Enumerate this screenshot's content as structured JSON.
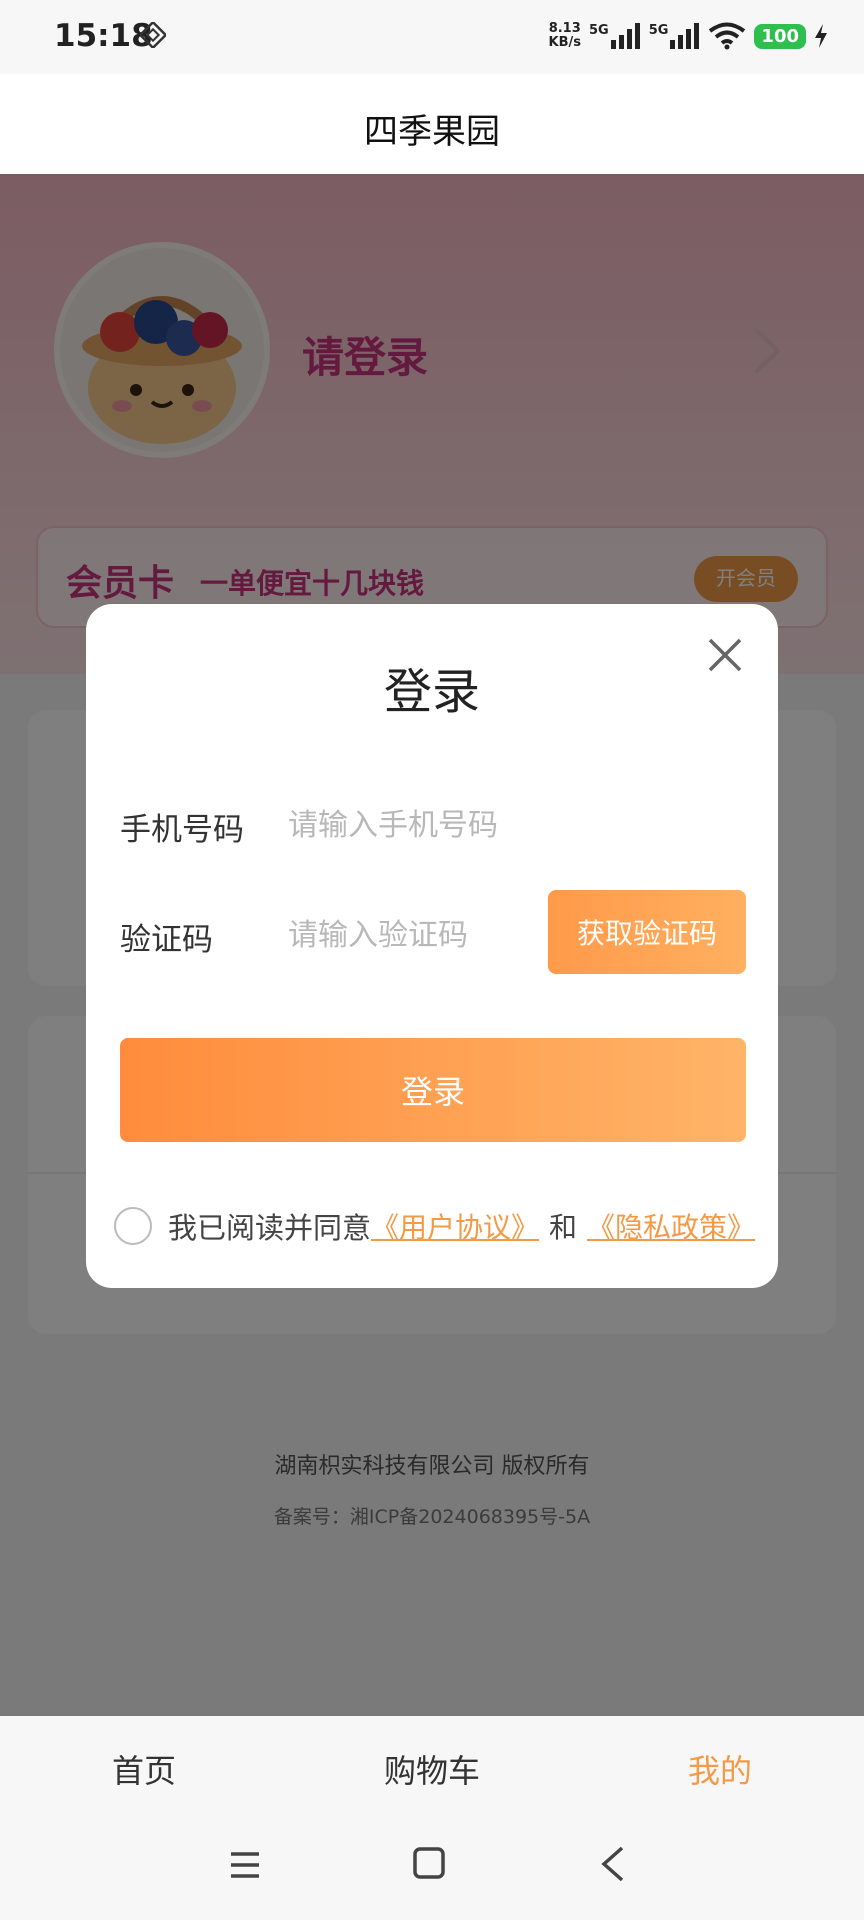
{
  "status_bar": {
    "time": "15:18",
    "net_speed_value": "8.13",
    "net_speed_unit": "KB/s",
    "sim1": "5G",
    "sim2": "5G",
    "battery": "100",
    "icons": [
      "nfc-icon",
      "signal-icon",
      "wifi-icon",
      "battery-icon",
      "charging-icon"
    ]
  },
  "header": {
    "title": "四季果园"
  },
  "profile": {
    "login_prompt": "请登录",
    "member_card": {
      "title": "会员卡",
      "subtitle": "一单便宜十几块钱",
      "button": "开会员"
    }
  },
  "footer": {
    "copyright": "湖南枳实科技有限公司 版权所有",
    "icp": "备案号：湘ICP备2024068395号-5A"
  },
  "modal": {
    "title": "登录",
    "phone_label": "手机号码",
    "phone_placeholder": "请输入手机号码",
    "phone_value": "",
    "code_label": "验证码",
    "code_placeholder": "请输入验证码",
    "code_value": "",
    "get_code_button": "获取验证码",
    "login_button": "登录",
    "agreement_text": "我已阅读并同意",
    "user_agreement": "《用户协议》",
    "and_text": "和",
    "privacy_policy": "《隐私政策》",
    "agreement_checked": false
  },
  "tab_bar": {
    "tabs": [
      {
        "label": "首页",
        "active": false
      },
      {
        "label": "购物车",
        "active": false
      },
      {
        "label": "我的",
        "active": true
      }
    ]
  },
  "colors": {
    "accent": "#f39a47",
    "brand_pink": "#c8357d",
    "header_gradient_top": "#f7b9c6",
    "battery_green": "#2fbf4f"
  }
}
